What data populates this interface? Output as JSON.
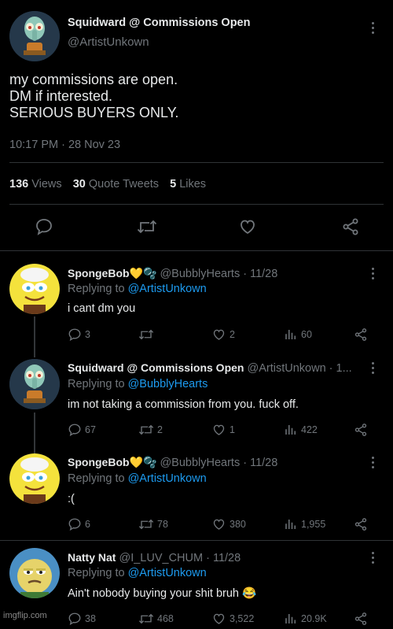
{
  "main_tweet": {
    "display_name": "Squidward @ Commissions Open",
    "handle": "@ArtistUnkown",
    "body_lines": [
      "my commissions are open.",
      "DM if interested.",
      "SERIOUS BUYERS ONLY."
    ],
    "timestamp": "10:17 PM · 28 Nov 23",
    "stats": {
      "views_count": "136",
      "views_label": "Views",
      "quotes_count": "30",
      "quotes_label": "Quote Tweets",
      "likes_count": "5",
      "likes_label": "Likes"
    },
    "action_icons": [
      "reply-icon",
      "retweet-icon",
      "like-icon",
      "share-icon"
    ]
  },
  "replies": [
    {
      "display_name": "SpongeBob💛🫧",
      "meta": "@BubblyHearts · 11/28",
      "replying_prefix": "Replying to",
      "replying_to": "@ArtistUnkown",
      "text": "i cant dm you",
      "reply_count": "3",
      "retweet_count": "",
      "like_count": "2",
      "view_count": "60"
    },
    {
      "display_name": "Squidward @ Commissions Open",
      "meta": "@ArtistUnkown · 1...",
      "replying_prefix": "Replying to",
      "replying_to": "@BubblyHearts",
      "text": "im not taking a commission from you. fuck off.",
      "reply_count": "67",
      "retweet_count": "2",
      "like_count": "1",
      "view_count": "422"
    },
    {
      "display_name": "SpongeBob💛🫧",
      "meta": "@BubblyHearts · 11/28",
      "replying_prefix": "Replying to",
      "replying_to": "@ArtistUnkown",
      "text": ":(",
      "reply_count": "6",
      "retweet_count": "78",
      "like_count": "380",
      "view_count": "1,955"
    },
    {
      "display_name": "Natty Nat",
      "meta": "@I_LUV_CHUM · 11/28",
      "replying_prefix": "Replying to",
      "replying_to": "@ArtistUnkown",
      "text": "Ain't nobody buying your shit bruh 😂",
      "reply_count": "38",
      "retweet_count": "468",
      "like_count": "3,522",
      "view_count": "20.9K"
    }
  ],
  "watermark": "imgflip.com",
  "colors": {
    "background": "#000000",
    "text": "#e7e9ea",
    "muted": "#71767b",
    "link": "#1d9bf0",
    "divider": "#2f3336"
  }
}
